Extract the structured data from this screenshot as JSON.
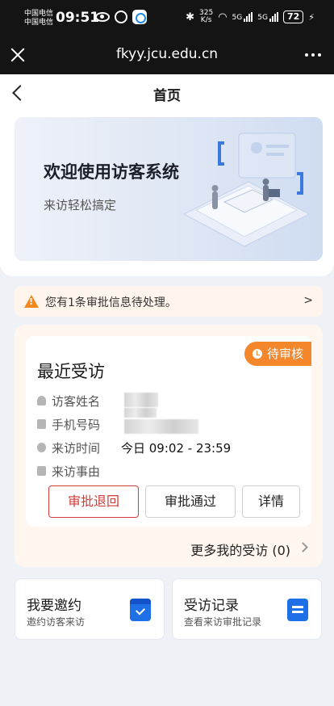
{
  "status_bar": {
    "carrier_1": "中国电信",
    "carrier_2": "中国电信",
    "time": "09:51",
    "net_speed_value": "325",
    "net_speed_unit": "K/s",
    "net_1": "5G",
    "net_2": "5G",
    "battery": "72"
  },
  "browser": {
    "url": "fkyy.jcu.edu.cn"
  },
  "nav": {
    "title": "首页"
  },
  "banner": {
    "title": "欢迎使用访客系统",
    "subtitle": "来访轻松搞定"
  },
  "notice": {
    "text": "您有1条审批信息待处理。",
    "arrow": ">"
  },
  "recent_visit": {
    "title": "最近受访",
    "status_badge": "待审核",
    "fields": [
      {
        "label": "访客姓名",
        "value": ""
      },
      {
        "label": "手机号码",
        "value": ""
      },
      {
        "label": "来访时间",
        "value": "今日 09:02 - 23:59"
      },
      {
        "label": "来访事由",
        "value": ""
      }
    ],
    "buttons": {
      "reject": "审批退回",
      "approve": "审批通过",
      "detail": "详情"
    },
    "more_link": "更多我的受访 (0)"
  },
  "tiles": [
    {
      "title": "我要邀约",
      "subtitle": "邀约访客来访",
      "icon": "calendar-check-icon"
    },
    {
      "title": "受访记录",
      "subtitle": "查看来访审批记录",
      "icon": "document-icon"
    }
  ],
  "colors": {
    "accent_orange": "#f4862b",
    "reject_red": "#d33a3a",
    "icon_blue": "#1f6fe6"
  }
}
